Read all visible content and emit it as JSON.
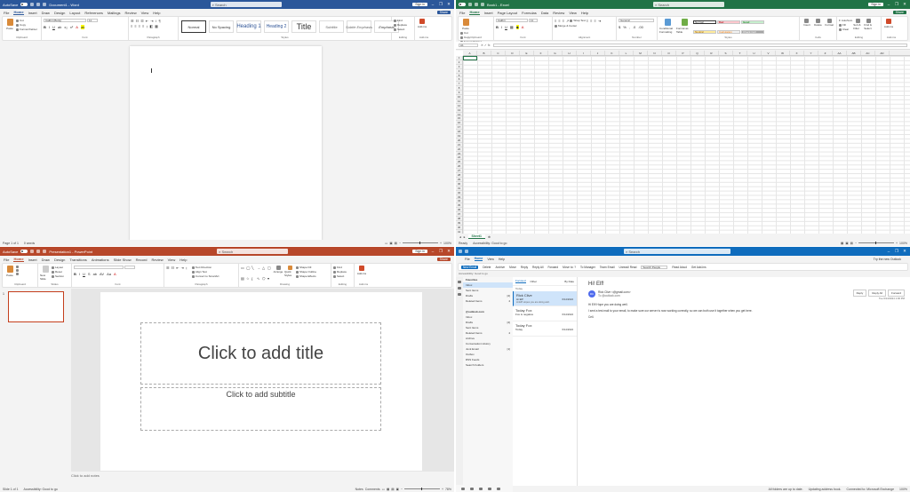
{
  "word": {
    "autosave": "AutoSave",
    "doc_title": "Document1 - Word",
    "search": "Search",
    "signin": "Sign in",
    "share": "Share",
    "tabs": [
      "File",
      "Home",
      "Insert",
      "Draw",
      "Design",
      "Layout",
      "References",
      "Mailings",
      "Review",
      "View",
      "Help"
    ],
    "active_tab": "Home",
    "font": "Calibri (Body)",
    "size": "11",
    "paste": "Paste",
    "cut": "Cut",
    "copy": "Copy",
    "format_painter": "Format Painter",
    "styles": [
      "Normal",
      "No Spacing",
      "Heading 1",
      "Heading 2",
      "Title",
      "Subtitle",
      "Subtle Emphasis",
      "Emphasis"
    ],
    "find": "Find",
    "replace": "Replace",
    "select": "Select",
    "add_ins": "Add-ins",
    "groups": [
      "Clipboard",
      "Font",
      "Paragraph",
      "Styles",
      "Editing",
      "Add-ins"
    ],
    "status_page": "Page 1 of 1",
    "status_words": "0 words",
    "zoom": "100%"
  },
  "excel": {
    "doc_title": "Book1 - Excel",
    "search": "Search",
    "signin": "Sign in",
    "share": "Share",
    "tabs": [
      "File",
      "Home",
      "Insert",
      "Page Layout",
      "Formulas",
      "Data",
      "Review",
      "View",
      "Help"
    ],
    "active_tab": "Home",
    "font": "Calibri",
    "size": "11",
    "paste": "Paste",
    "cut": "Cut",
    "copy": "Copy",
    "format_painter": "Format Painter",
    "wrap": "Wrap Text",
    "merge": "Merge & Center",
    "number_format": "General",
    "cond_format": "Conditional Formatting",
    "format_table": "Format as Table",
    "cell_styles": [
      "Normal",
      "Bad",
      "Good",
      "Neutral",
      "Calculation",
      "Check Cell"
    ],
    "insert": "Insert",
    "delete": "Delete",
    "format": "Format",
    "autosum": "AutoSum",
    "fill": "Fill",
    "clear": "Clear",
    "sort": "Sort & Filter",
    "find": "Find & Select",
    "add_ins": "Add-ins",
    "groups": [
      "Clipboard",
      "Font",
      "Alignment",
      "Number",
      "Styles",
      "Cells",
      "Editing",
      "Add-ins"
    ],
    "namebox": "A1",
    "columns": [
      "A",
      "B",
      "C",
      "D",
      "E",
      "F",
      "G",
      "H",
      "I",
      "J",
      "K",
      "L",
      "M",
      "N",
      "O",
      "P",
      "Q",
      "R",
      "S",
      "T",
      "U",
      "V",
      "W",
      "X",
      "Y",
      "Z",
      "AA",
      "AB",
      "AC",
      "AD"
    ],
    "rows": [
      "1",
      "2",
      "3",
      "4",
      "5",
      "6",
      "7",
      "8",
      "9",
      "10",
      "11",
      "12",
      "13",
      "14",
      "15",
      "16",
      "17",
      "18",
      "19",
      "20",
      "21",
      "22",
      "23",
      "24",
      "25",
      "26",
      "27",
      "28",
      "29",
      "30",
      "31",
      "32",
      "33",
      "34",
      "35",
      "36",
      "37",
      "38",
      "39",
      "40",
      "41",
      "42"
    ],
    "sheet": "Sheet1",
    "status_ready": "Ready",
    "status_access": "Accessibility: Good to go",
    "zoom": "100%"
  },
  "ppt": {
    "autosave": "AutoSave",
    "doc_title": "Presentation1 - PowerPoint",
    "search": "Search",
    "signin": "Sign in",
    "share": "Share",
    "tabs": [
      "File",
      "Home",
      "Insert",
      "Draw",
      "Design",
      "Transitions",
      "Animations",
      "Slide Show",
      "Record",
      "Review",
      "View",
      "Help"
    ],
    "active_tab": "Home",
    "paste": "Paste",
    "new_slide": "New Slide",
    "layout": "Layout",
    "reset": "Reset",
    "section": "Section",
    "text_direction": "Text Direction",
    "align_text": "Align Text",
    "smartart": "Convert to SmartArt",
    "arrange": "Arrange",
    "quick_styles": "Quick Styles",
    "shape_fill": "Shape Fill",
    "shape_outline": "Shape Outline",
    "shape_effects": "Shape Effects",
    "find": "Find",
    "replace": "Replace",
    "select": "Select",
    "add_ins": "Add-ins",
    "groups": [
      "Clipboard",
      "Slides",
      "Font",
      "Paragraph",
      "Drawing",
      "Editing",
      "Add-ins"
    ],
    "slide_number": "1",
    "title_placeholder": "Click to add title",
    "subtitle_placeholder": "Click to add subtitle",
    "notes_placeholder": "Click to add notes",
    "status_slide": "Slide 1 of 1",
    "status_access": "Accessibility: Good to go",
    "notes_btn": "Notes",
    "comments_btn": "Comments",
    "zoom": "78%"
  },
  "outlook": {
    "search": "Search",
    "tabs": [
      "Home",
      "View",
      "Help"
    ],
    "tab_file": "File",
    "active_tab": "Home",
    "new_email": "New Email",
    "commands": [
      "Delete",
      "Archive",
      "Move",
      "Reply",
      "Reply All",
      "Forward",
      "Move to: ?",
      "To Manager",
      "Team Email",
      "Unread/ Read"
    ],
    "search_people": "Search People",
    "read_aloud": "Read Aloud",
    "get_addins": "Get Add-ins",
    "try_new": "Try the new Outlook",
    "info_line": "Accessibility: Good to go",
    "favorites": "Favorites",
    "fav_items": [
      {
        "label": "Inbox",
        "count": ""
      },
      {
        "label": "Sent Items",
        "count": ""
      },
      {
        "label": "Drafts",
        "count": "[2]"
      },
      {
        "label": "Deleted Items",
        "count": "4"
      }
    ],
    "account": "@outlook.com",
    "acc_items": [
      {
        "label": "Inbox",
        "count": ""
      },
      {
        "label": "Drafts",
        "count": "[2]"
      },
      {
        "label": "Sent Items",
        "count": ""
      },
      {
        "label": "Deleted Items",
        "count": "4"
      },
      {
        "label": "Archive",
        "count": ""
      },
      {
        "label": "Conversation History",
        "count": ""
      },
      {
        "label": "Junk Email",
        "count": "[1]"
      },
      {
        "label": "Outbox",
        "count": ""
      },
      {
        "label": "RSS Feeds",
        "count": ""
      },
      {
        "label": "Search Folders",
        "count": ""
      }
    ],
    "focused": "Focused",
    "other": "Other",
    "by_date": "By Date",
    "group_today": "Today",
    "messages": [
      {
        "from": "Rick Clive",
        "subject": "Hi Elf!",
        "preview": "Hi Elf! Hopes you are doing well.",
        "date": "6/14/2024"
      },
      {
        "from": "Today Fox",
        "subject": "Fox is negative",
        "preview": "",
        "date": "6/14/2024"
      },
      {
        "from": "Today Fox",
        "subject": "Today",
        "preview": "",
        "date": "6/14/2024"
      }
    ],
    "reading_subject": "Hi! Elf!",
    "sender_initials": "RC",
    "sender_name": "Rick Clive",
    "sender_email": "@gmail.com",
    "to": "To",
    "to_addr": "@outlook.com",
    "reply": "Reply",
    "reply_all": "Reply All",
    "forward": "Forward",
    "date_line": "Tue 6/14/2024 1:00 PM",
    "body": [
      "Hi Elf! Hope you are doing well.",
      "I sent a test mail to your email, to make sure our server is now working correctly, so we can both use it together when you get here.",
      "Cell."
    ],
    "status_left": "All folders are up to date.",
    "status_mid": "Updating address book.",
    "status_right": "Connected to: Microsoft Exchange",
    "zoom": "100%"
  }
}
